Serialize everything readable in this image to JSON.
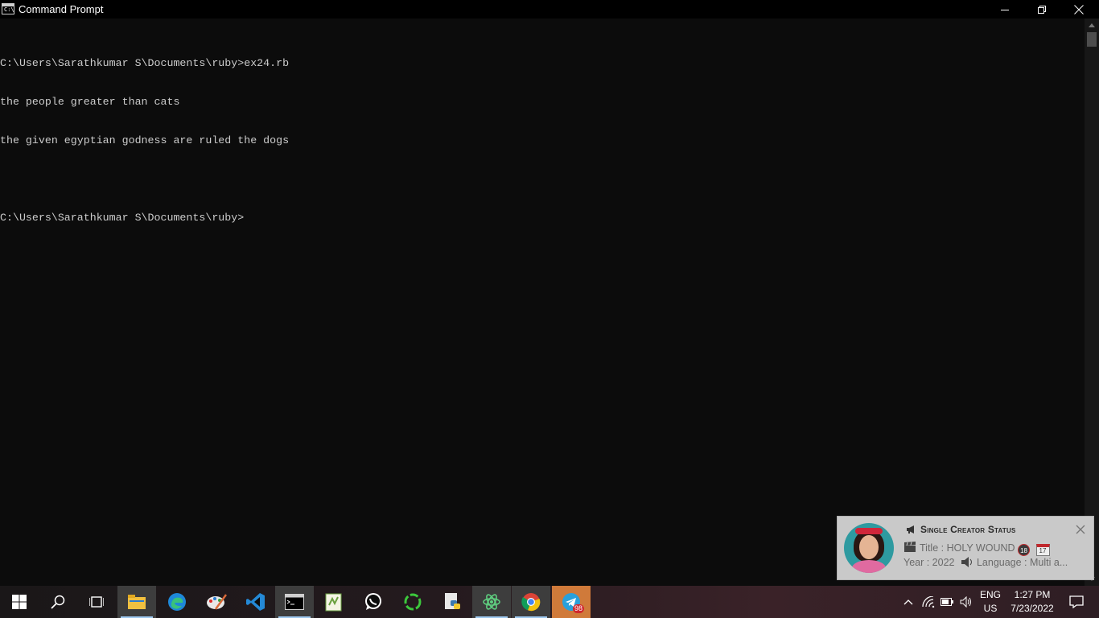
{
  "window": {
    "title": "Command Prompt",
    "icon": "cmd-icon",
    "icon_prompt": "C:\\"
  },
  "console": {
    "lines": [
      "C:\\Users\\Sarathkumar S\\Documents\\ruby>ex24.rb",
      "the people greater than cats",
      "the given egyptian godness are ruled the dogs",
      "",
      "C:\\Users\\Sarathkumar S\\Documents\\ruby>"
    ]
  },
  "notification": {
    "heading": "Single Creator Status",
    "heading_icon": "megaphone-icon",
    "line1_label": "Title : HOLY WOUND",
    "badge": "18",
    "calendar_day": "17",
    "line2_year": "Year : 2022",
    "line2_language": "Language : Multi a..."
  },
  "taskbar": {
    "apps": [
      {
        "name": "start",
        "icon": "windows-logo-icon"
      },
      {
        "name": "search",
        "icon": "search-icon"
      },
      {
        "name": "task-view",
        "icon": "task-view-icon"
      },
      {
        "name": "file-explorer",
        "icon": "folder-icon"
      },
      {
        "name": "edge",
        "icon": "edge-icon"
      },
      {
        "name": "paint",
        "icon": "paint-palette-icon"
      },
      {
        "name": "vscode",
        "icon": "vscode-icon"
      },
      {
        "name": "command-prompt",
        "icon": "cmd-icon"
      },
      {
        "name": "notepad-plus",
        "icon": "notepad-icon"
      },
      {
        "name": "whatsapp",
        "icon": "whatsapp-icon"
      },
      {
        "name": "refresh-app",
        "icon": "circle-arrows-icon"
      },
      {
        "name": "python",
        "icon": "python-icon"
      },
      {
        "name": "atom",
        "icon": "atom-icon"
      },
      {
        "name": "chrome",
        "icon": "chrome-icon"
      },
      {
        "name": "telegram",
        "icon": "telegram-icon",
        "badge": "98"
      }
    ],
    "tray": {
      "language": "ENG",
      "region": "US",
      "time": "1:27 PM",
      "date": "7/23/2022"
    }
  }
}
